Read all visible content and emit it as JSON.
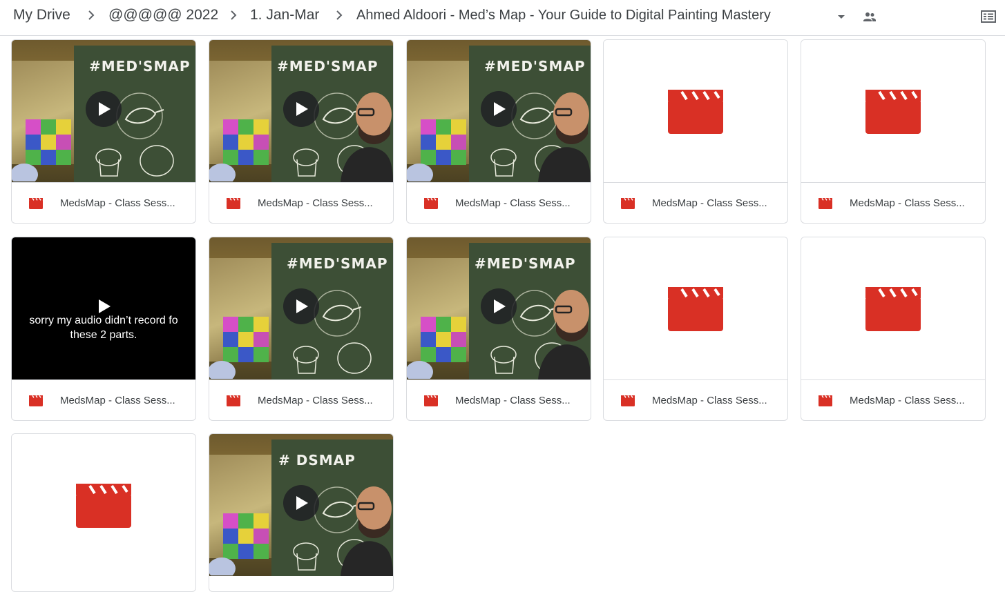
{
  "breadcrumb": {
    "items": [
      "My Drive",
      "@@@@@ 2022",
      "1. Jan-Mar",
      "Ahmed Aldoori - Med’s Map - Your Guide to Digital Painting Mastery"
    ]
  },
  "icons": {
    "separator": "chevron-right-icon",
    "folder_menu": "caret-down-icon",
    "shared": "people-icon",
    "view_toggle": "list-view-icon",
    "file_type": "video-icon"
  },
  "colors": {
    "accent_red": "#d93025",
    "border": "#dadce0",
    "text": "#3c4043"
  },
  "files": [
    {
      "name": "MedsMap - Class Sess...",
      "thumb": "video",
      "board_title": "#MED'SMAP"
    },
    {
      "name": "MedsMap - Class Sess...",
      "thumb": "video",
      "board_title": "#MED'SMAP"
    },
    {
      "name": "MedsMap - Class Sess...",
      "thumb": "video",
      "board_title": "#MED'SMAP"
    },
    {
      "name": "MedsMap - Class Sess...",
      "thumb": "icon"
    },
    {
      "name": "MedsMap - Class Sess...",
      "thumb": "icon"
    },
    {
      "name": "MedsMap - Class Sess...",
      "thumb": "black",
      "caption": "sorry my audio didn’t record fo\nthese 2 parts."
    },
    {
      "name": "MedsMap - Class Sess...",
      "thumb": "video",
      "board_title": "#MED'SMAP"
    },
    {
      "name": "MedsMap - Class Sess...",
      "thumb": "video",
      "board_title": "#MED'SMAP"
    },
    {
      "name": "MedsMap - Class Sess...",
      "thumb": "icon"
    },
    {
      "name": "MedsMap - Class Sess...",
      "thumb": "icon"
    },
    {
      "name": "",
      "thumb": "icon"
    },
    {
      "name": "",
      "thumb": "video",
      "board_title": "#  DSMAP"
    }
  ]
}
